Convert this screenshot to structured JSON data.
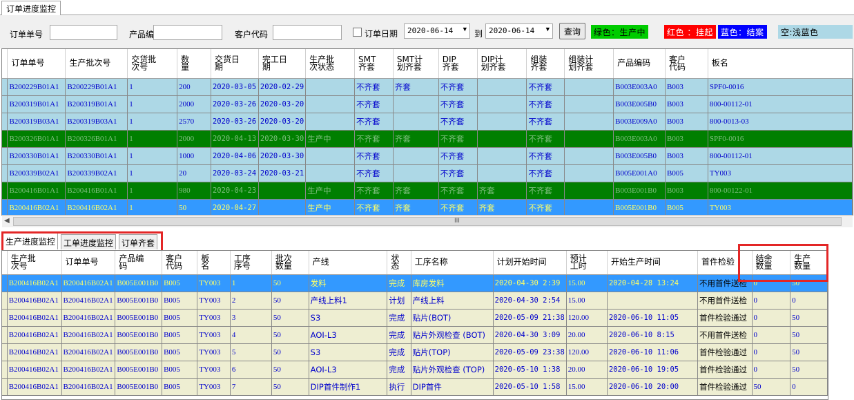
{
  "window_tab": "订单进度监控",
  "toolbar": {
    "order_no_label": "订单单号",
    "order_no_value": "",
    "product_code_label": "产品编",
    "product_code_value": "",
    "customer_code_label": "客户代码",
    "customer_code_value": "",
    "order_date_label": "订单日期",
    "date_from": "2020-06-14",
    "to_label": "到",
    "date_to": "2020-06-14",
    "query_button": "查询",
    "legend_green": "绿色：生产中",
    "legend_red": "红色 ：挂起",
    "legend_blue": "蓝色：结案",
    "legend_lightblue": "空:浅蓝色"
  },
  "colors": {
    "legend_green": "#00cc00",
    "legend_red": "#ff0000",
    "legend_blue": "#0000ff",
    "legend_lightblue": "#add8e6",
    "row_production": "#007f00",
    "row_selected": "#3399ff"
  },
  "top_grid": {
    "headers": [
      "订单单号",
      "生产批次号",
      "交货批\n次号",
      "数\n量",
      "交货日\n期",
      "完工日\n期",
      "生产批\n次状态",
      "SMT\n齐套",
      "SMT计\n划齐套",
      "DIP\n齐套",
      "DIP计\n划齐套",
      "组装\n齐套",
      "组装计\n划齐套",
      "产品编码",
      "客户\n代码",
      "板名"
    ],
    "rows": [
      {
        "style": "blue",
        "cells": [
          "B200229B01A1",
          "B200229B01A1",
          "1",
          "200",
          "2020-03-05",
          "2020-02-29",
          "",
          "不齐套",
          "齐套",
          "不齐套",
          "",
          "不齐套",
          "",
          "B003E003A0",
          "B003",
          "SPF0-0016"
        ]
      },
      {
        "style": "blue",
        "cells": [
          "B200319B01A1",
          "B200319B01A1",
          "1",
          "2000",
          "2020-03-26",
          "2020-03-20",
          "",
          "不齐套",
          "",
          "不齐套",
          "",
          "不齐套",
          "",
          "B003E005B0",
          "B003",
          "800-00112-01"
        ]
      },
      {
        "style": "blue",
        "cells": [
          "B200319B03A1",
          "B200319B03A1",
          "1",
          "2570",
          "2020-03-26",
          "2020-03-20",
          "",
          "不齐套",
          "",
          "不齐套",
          "",
          "不齐套",
          "",
          "B003E009A0",
          "B003",
          "800-0013-03"
        ]
      },
      {
        "style": "green",
        "cells": [
          "B200326B01A1",
          "B200326B01A1",
          "1",
          "2000",
          "2020-04-13",
          "2020-03-30",
          "生产中",
          "不齐套",
          "齐套",
          "不齐套",
          "",
          "不齐套",
          "",
          "B003E003A0",
          "B003",
          "SPF0-0016"
        ]
      },
      {
        "style": "blue",
        "cells": [
          "B200330B01A1",
          "B200330B01A1",
          "1",
          "1000",
          "2020-04-06",
          "2020-03-30",
          "",
          "不齐套",
          "",
          "不齐套",
          "",
          "不齐套",
          "",
          "B003E005B0",
          "B003",
          "800-00112-01"
        ]
      },
      {
        "style": "blue",
        "cells": [
          "B200339B02A1",
          "B200339B02A1",
          "1",
          "20",
          "2020-03-24",
          "2020-03-21",
          "",
          "不齐套",
          "",
          "不齐套",
          "",
          "不齐套",
          "",
          "B005E001A0",
          "B005",
          "TY003"
        ]
      },
      {
        "style": "green",
        "cells": [
          "B200416B01A1",
          "B200416B01A1",
          "1",
          "980",
          "2020-04-23",
          "",
          "生产中",
          "不齐套",
          "齐套",
          "不齐套",
          "齐套",
          "不齐套",
          "",
          "B003E001B0",
          "B003",
          "800-00122-01"
        ]
      },
      {
        "style": "selblue",
        "cells": [
          "B200416B02A1",
          "B200416B02A1",
          "1",
          "50",
          "2020-04-27",
          "",
          "生产中",
          "不齐套",
          "齐套",
          "不齐套",
          "齐套",
          "不齐套",
          "",
          "B005E001B0",
          "B005",
          "TY003"
        ]
      }
    ]
  },
  "scroll_grip": "III",
  "bottom_tabs": [
    "生产进度监控",
    "工单进度监控",
    "订单齐套"
  ],
  "bottom_grid": {
    "headers": [
      "生产批\n次号",
      "订单单号",
      "产品编\n码",
      "客户\n代码",
      "板\n名",
      "工序\n序号",
      "批次\n数量",
      "产线",
      "状\n态",
      "工序名称",
      "计划开始时间",
      "预计\n工时",
      "开始生产时间",
      "首件检验",
      "结余\n数量",
      "生产\n数量"
    ],
    "rows": [
      {
        "style": "sel2",
        "cells": [
          "B200416B02A1",
          "B200416B02A1",
          "B005E001B0",
          "B005",
          "TY003",
          "1",
          "50",
          "发料",
          "完成",
          "库房发料",
          "2020-04-30 2:39",
          "15.00",
          "2020-04-28 13:24",
          "不用首件送检",
          "0",
          "50"
        ]
      },
      {
        "style": "khaki",
        "cells": [
          "B200416B02A1",
          "B200416B02A1",
          "B005E001B0",
          "B005",
          "TY003",
          "2",
          "50",
          "产线上料1",
          "计划",
          "产线上料",
          "2020-04-30 2:54",
          "15.00",
          "",
          "不用首件送检",
          "0",
          "0"
        ]
      },
      {
        "style": "khaki",
        "cells": [
          "B200416B02A1",
          "B200416B02A1",
          "B005E001B0",
          "B005",
          "TY003",
          "3",
          "50",
          "S3",
          "完成",
          "贴片(BOT)",
          "2020-05-09 21:38",
          "120.00",
          "2020-06-10 11:05",
          "首件检验通过",
          "0",
          "50"
        ]
      },
      {
        "style": "khaki",
        "cells": [
          "B200416B02A1",
          "B200416B02A1",
          "B005E001B0",
          "B005",
          "TY003",
          "4",
          "50",
          "AOI-L3",
          "完成",
          "贴片外观检查 (BOT)",
          "2020-04-30 3:09",
          "20.00",
          "2020-06-10 8:15",
          "不用首件送检",
          "0",
          "50"
        ]
      },
      {
        "style": "khaki",
        "cells": [
          "B200416B02A1",
          "B200416B02A1",
          "B005E001B0",
          "B005",
          "TY003",
          "5",
          "50",
          "S3",
          "完成",
          "贴片(TOP)",
          "2020-05-09 23:38",
          "120.00",
          "2020-06-10 11:06",
          "首件检验通过",
          "0",
          "50"
        ]
      },
      {
        "style": "khaki",
        "cells": [
          "B200416B02A1",
          "B200416B02A1",
          "B005E001B0",
          "B005",
          "TY003",
          "6",
          "50",
          "AOI-L3",
          "完成",
          "贴片外观检查 (TOP)",
          "2020-05-10 1:38",
          "20.00",
          "2020-06-10 19:05",
          "首件检验通过",
          "0",
          "50"
        ]
      },
      {
        "style": "khaki",
        "cells": [
          "B200416B02A1",
          "B200416B02A1",
          "B005E001B0",
          "B005",
          "TY003",
          "7",
          "50",
          "DIP首件制作1",
          "执行",
          "DIP首件",
          "2020-05-10 1:58",
          "15.00",
          "2020-06-10 20:00",
          "首件检验通过",
          "50",
          "0"
        ]
      }
    ]
  }
}
